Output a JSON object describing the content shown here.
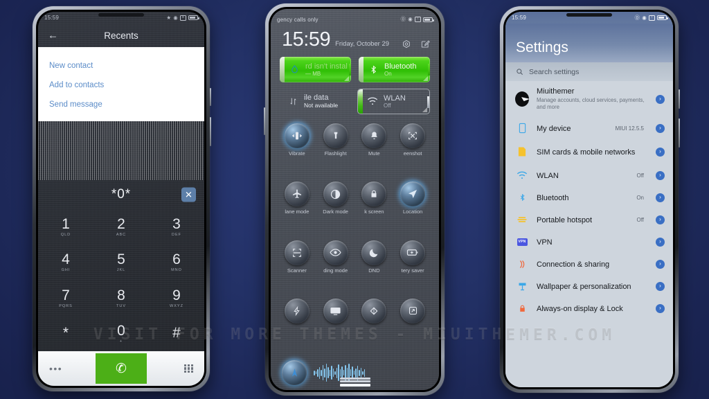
{
  "watermark": "VISIT FOR MORE THEMES - MIUITHEMER.COM",
  "phone1": {
    "statusbar": {
      "time": "15:59"
    },
    "appbar": {
      "back_icon": "arrow-left-icon",
      "title": "Recents"
    },
    "menu_items": [
      {
        "label": "New contact"
      },
      {
        "label": "Add to contacts"
      },
      {
        "label": "Send message"
      }
    ],
    "dialer": {
      "number": "*0*",
      "clear_label": "✕",
      "keys": [
        {
          "digit": "1",
          "sub": "QLD"
        },
        {
          "digit": "2",
          "sub": "ABC"
        },
        {
          "digit": "3",
          "sub": "DEF"
        },
        {
          "digit": "4",
          "sub": "GHI"
        },
        {
          "digit": "5",
          "sub": "JKL"
        },
        {
          "digit": "6",
          "sub": "MNO"
        },
        {
          "digit": "7",
          "sub": "PQRS"
        },
        {
          "digit": "8",
          "sub": "TUV"
        },
        {
          "digit": "9",
          "sub": "WXYZ"
        },
        {
          "digit": "*",
          "sub": ""
        },
        {
          "digit": "0",
          "sub": "+"
        },
        {
          "digit": "#",
          "sub": ""
        }
      ],
      "more_icon": "more-horizontal-icon",
      "call_icon": "phone-call-icon",
      "keypad_icon": "keypad-grid-icon"
    }
  },
  "phone2": {
    "statusbar": {
      "carrier": "gency calls only"
    },
    "clock": {
      "time": "15:59",
      "date": "Friday, October 29"
    },
    "header_icons": [
      "settings-gear-icon",
      "edit-pencil-icon"
    ],
    "battery_toggles": [
      {
        "title": "rd isn't instal",
        "sub": "— MB",
        "icon": "water-drop-icon",
        "state": "on"
      },
      {
        "title": "Bluetooth",
        "sub": "On",
        "icon": "bluetooth-icon",
        "state": "on"
      },
      {
        "title": "ile data",
        "sub": "Not available",
        "icon": "mobile-data-icon",
        "state": "plain"
      },
      {
        "title": "WLAN",
        "sub": "Off",
        "icon": "wifi-icon",
        "state": "off"
      }
    ],
    "tiles": [
      {
        "label": "Vibrate",
        "icon": "vibrate-icon",
        "lit": true
      },
      {
        "label": "Flashlight",
        "icon": "flashlight-icon",
        "lit": false
      },
      {
        "label": "Mute",
        "icon": "bell-icon",
        "lit": false
      },
      {
        "label": "eenshot",
        "icon": "screenshot-icon",
        "lit": false
      },
      {
        "label": "lane mode",
        "icon": "airplane-icon",
        "lit": false
      },
      {
        "label": "Dark mode",
        "icon": "dark-mode-icon",
        "lit": false
      },
      {
        "label": "k screen",
        "icon": "lock-icon",
        "lit": false
      },
      {
        "label": "Location",
        "icon": "location-arrow-icon",
        "lit": true
      },
      {
        "label": "Scanner",
        "icon": "scanner-icon",
        "lit": false
      },
      {
        "label": "ding mode",
        "icon": "eye-icon",
        "lit": false
      },
      {
        "label": "DND",
        "icon": "moon-icon",
        "lit": false
      },
      {
        "label": "tery saver",
        "icon": "battery-saver-icon",
        "lit": false
      },
      {
        "label": "",
        "icon": "lightning-icon",
        "lit": false
      },
      {
        "label": "",
        "icon": "cast-screen-icon",
        "lit": false
      },
      {
        "label": "",
        "icon": "sync-icon",
        "lit": false
      },
      {
        "label": "",
        "icon": "rotate-screen-icon",
        "lit": false
      }
    ],
    "footer": {
      "compass_icon": "compass-icon",
      "waveform_icon": "audio-waveform-icon"
    }
  },
  "phone3": {
    "statusbar": {
      "time": "15:59"
    },
    "title": "Settings",
    "search": {
      "placeholder": "Search settings",
      "icon": "search-icon"
    },
    "rows": [
      {
        "title": "Miuithemer",
        "sub": "Manage accounts, cloud services, payments, and more",
        "value": "",
        "icon": "account-avatar"
      },
      {
        "title": "My device",
        "sub": "",
        "value": "MIUI 12.5.5",
        "icon": "device-icon"
      },
      {
        "title": "SIM cards & mobile networks",
        "sub": "",
        "value": "",
        "icon": "sim-card-icon"
      },
      {
        "title": "WLAN",
        "sub": "",
        "value": "Off",
        "icon": "wifi-icon"
      },
      {
        "title": "Bluetooth",
        "sub": "",
        "value": "On",
        "icon": "bluetooth-icon"
      },
      {
        "title": "Portable hotspot",
        "sub": "",
        "value": "Off",
        "icon": "hotspot-icon"
      },
      {
        "title": "VPN",
        "sub": "",
        "value": "",
        "icon": "vpn-icon"
      },
      {
        "title": "Connection & sharing",
        "sub": "",
        "value": "",
        "icon": "connection-sharing-icon"
      },
      {
        "title": "Wallpaper & personalization",
        "sub": "",
        "value": "",
        "icon": "wallpaper-icon"
      },
      {
        "title": "Always-on display & Lock",
        "sub": "",
        "value": "",
        "icon": "lock-screen-icon"
      }
    ],
    "chevron_glyph": "›"
  },
  "colors": {
    "background": "#233166",
    "accent_green": "#30bf06",
    "call_green": "#4caf17",
    "link_blue": "#5b8cc8",
    "chevron_blue": "#3a6fc4",
    "header_blue": "#6a7ea5"
  }
}
